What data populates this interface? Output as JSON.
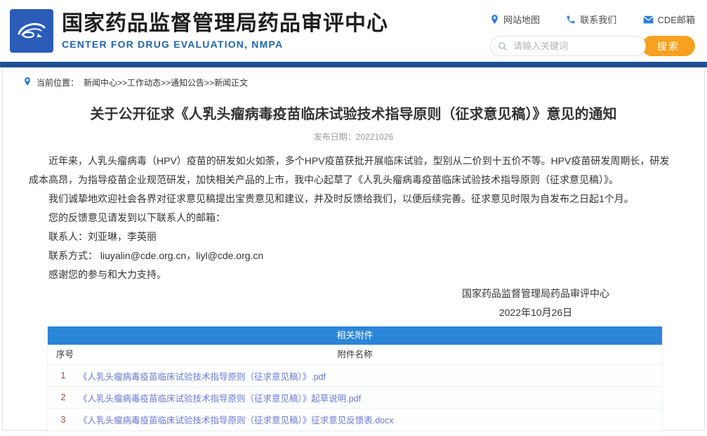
{
  "header": {
    "org_name_cn": "国家药品监督管理局药品审评中心",
    "org_name_en": "CENTER FOR DRUG EVALUATION, NMPA",
    "logo_icon": "cde-swirl-logo",
    "quick_links": [
      {
        "icon": "location-pin-icon",
        "label": "网站地图"
      },
      {
        "icon": "phone-icon",
        "label": "联系我们"
      },
      {
        "icon": "envelope-icon",
        "label": "CDE邮箱"
      }
    ],
    "search": {
      "icon": "search-icon",
      "placeholder": "请输入关键词",
      "button_label": "搜索"
    }
  },
  "breadcrumb": {
    "icon": "location-pin-icon",
    "prefix": "当前位置：",
    "path": "新闻中心>>工作动态>>通知公告>>新闻正文"
  },
  "article": {
    "title": "关于公开征求《人乳头瘤病毒疫苗临床试验技术指导原则（征求意见稿）》意见的通知",
    "publish_date": "发布日期：20221026",
    "paragraphs": [
      "近年来，人乳头瘤病毒（HPV）疫苗的研发如火如荼，多个HPV疫苗获批开展临床试验，型别从二价到十五价不等。HPV疫苗研发周期长，研发成本高昂，为指导疫苗企业规范研发，加快相关产品的上市，我中心起草了《人乳头瘤病毒疫苗临床试验技术指导原则（征求意见稿）》。",
      "我们诚挚地欢迎社会各界对征求意见稿提出宝贵意见和建议，并及时反馈给我们，以便后续完善。征求意见时限为自发布之日起1个月。",
      "您的反馈意见请发到以下联系人的邮箱：",
      "联系人：刘亚琳，李英丽",
      "联系方式： liuyalin@cde.org.cn，liyl@cde.org.cn",
      "感谢您的参与和大力支持。"
    ],
    "signature": {
      "org": "国家药品监督管理局药品审评中心",
      "date": "2022年10月26日"
    }
  },
  "attachments": {
    "title": "相关附件",
    "col_no": "序号",
    "col_name": "附件名称",
    "rows": [
      {
        "no": "1",
        "name": "《人乳头瘤病毒疫苗临床试验技术指导原则（征求意见稿）》.pdf"
      },
      {
        "no": "2",
        "name": "《人乳头瘤病毒疫苗临床试验技术指导原则（征求意见稿）》起草说明.pdf"
      },
      {
        "no": "3",
        "name": "《人乳头瘤病毒疫苗临床试验技术指导原则（征求意见稿）》征求意见反馈表.docx"
      }
    ]
  },
  "colors": {
    "navy_bar": "#1e4f95",
    "table_header_blue": "#2b85d8",
    "search_button_orange": "#f8a01f",
    "attachment_link": "#6b79d6",
    "row_number_red": "#9a4b45",
    "icon_blue": "#2f7de1",
    "org_en_blue": "#2065b0",
    "logo_blue": "#2a5cb8"
  }
}
